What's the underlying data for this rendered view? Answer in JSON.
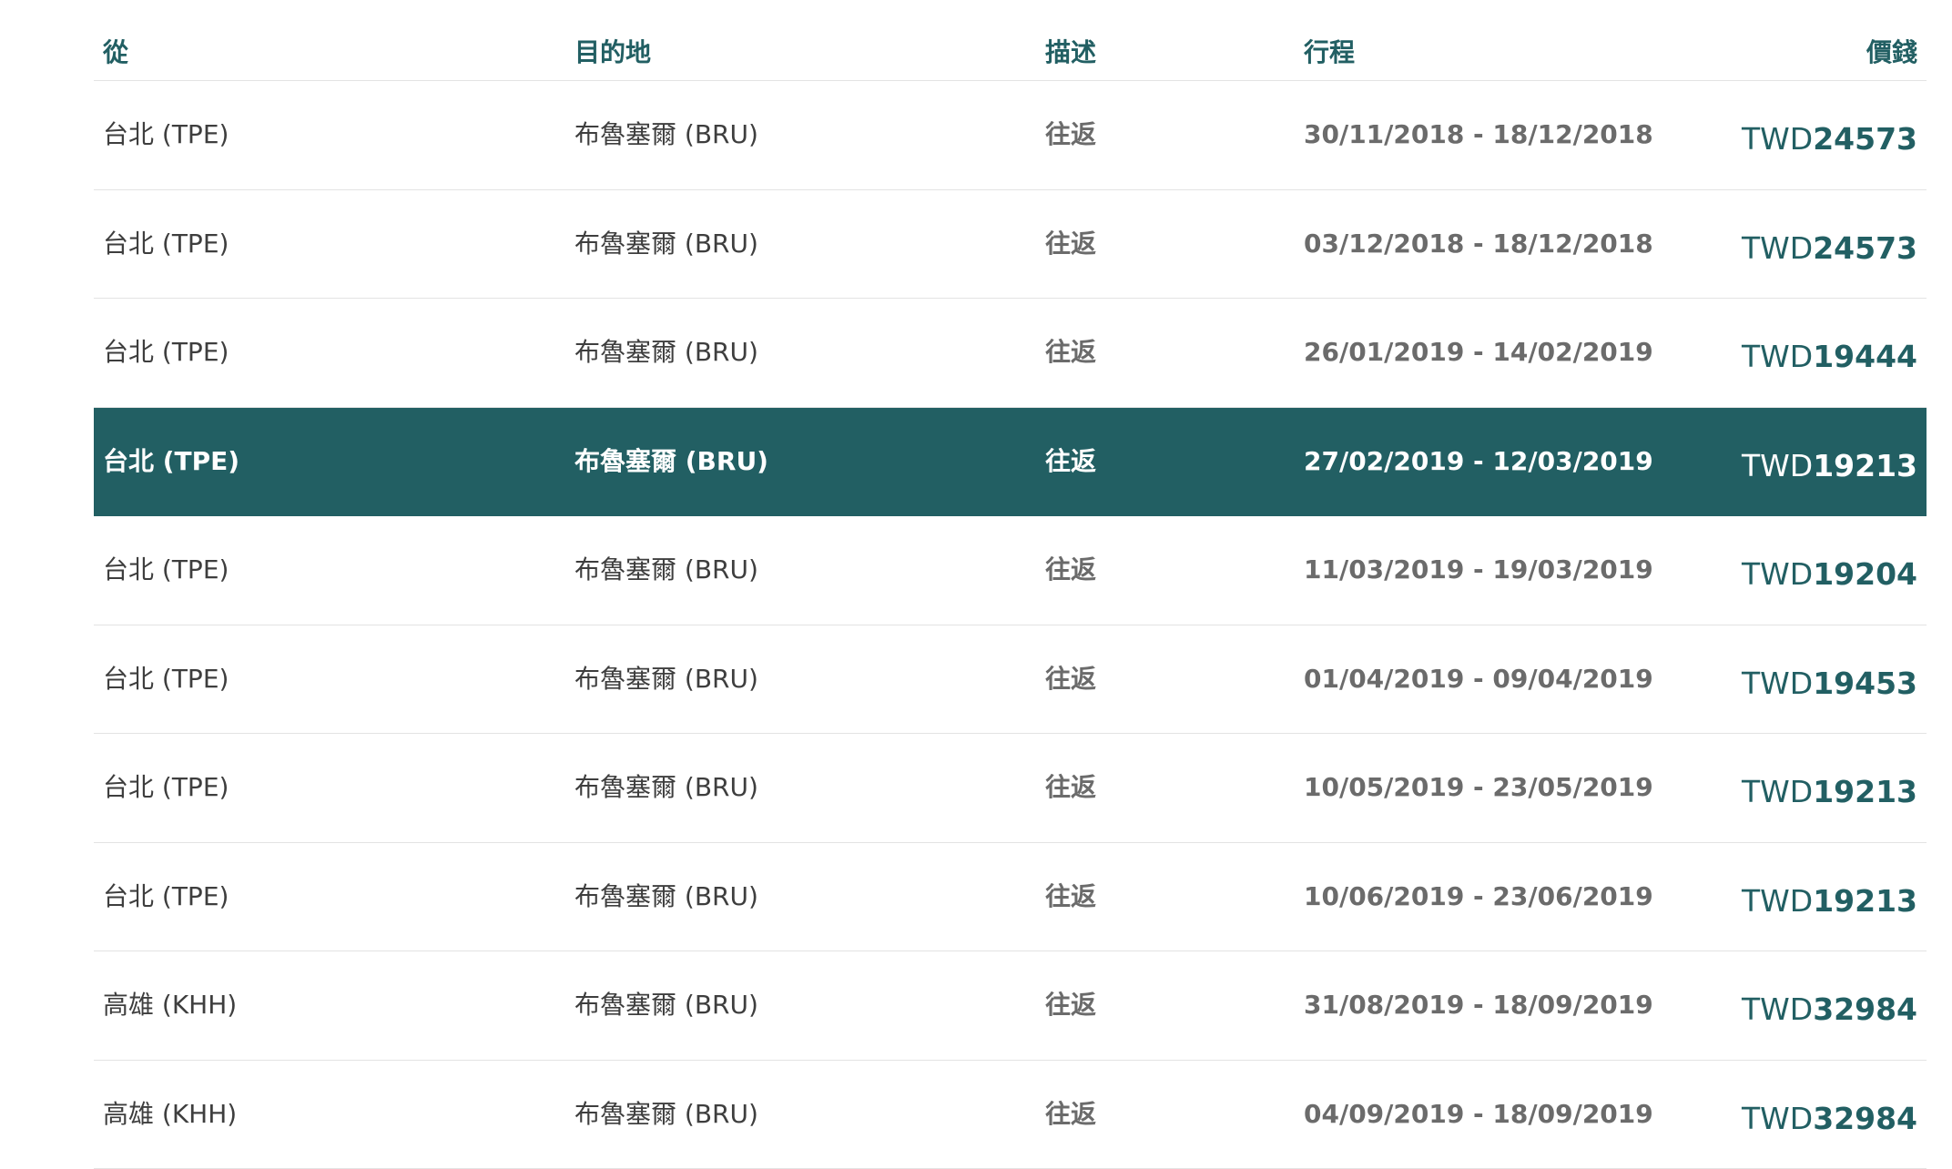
{
  "table": {
    "columns": {
      "from": "從",
      "to": "目的地",
      "description": "描述",
      "itinerary": "行程",
      "price": "價錢"
    },
    "currency": "TWD",
    "selected_index": 3,
    "rows": [
      {
        "from": "台北 (TPE)",
        "to": "布魯塞爾 (BRU)",
        "description": "往返",
        "itinerary": "30/11/2018 - 18/12/2018",
        "price": "24573"
      },
      {
        "from": "台北 (TPE)",
        "to": "布魯塞爾 (BRU)",
        "description": "往返",
        "itinerary": "03/12/2018 - 18/12/2018",
        "price": "24573"
      },
      {
        "from": "台北 (TPE)",
        "to": "布魯塞爾 (BRU)",
        "description": "往返",
        "itinerary": "26/01/2019 - 14/02/2019",
        "price": "19444"
      },
      {
        "from": "台北 (TPE)",
        "to": "布魯塞爾 (BRU)",
        "description": "往返",
        "itinerary": "27/02/2019 - 12/03/2019",
        "price": "19213"
      },
      {
        "from": "台北 (TPE)",
        "to": "布魯塞爾 (BRU)",
        "description": "往返",
        "itinerary": "11/03/2019 - 19/03/2019",
        "price": "19204"
      },
      {
        "from": "台北 (TPE)",
        "to": "布魯塞爾 (BRU)",
        "description": "往返",
        "itinerary": "01/04/2019 - 09/04/2019",
        "price": "19453"
      },
      {
        "from": "台北 (TPE)",
        "to": "布魯塞爾 (BRU)",
        "description": "往返",
        "itinerary": "10/05/2019 - 23/05/2019",
        "price": "19213"
      },
      {
        "from": "台北 (TPE)",
        "to": "布魯塞爾 (BRU)",
        "description": "往返",
        "itinerary": "10/06/2019 - 23/06/2019",
        "price": "19213"
      },
      {
        "from": "高雄 (KHH)",
        "to": "布魯塞爾 (BRU)",
        "description": "往返",
        "itinerary": "31/08/2019 - 18/09/2019",
        "price": "32984"
      },
      {
        "from": "高雄 (KHH)",
        "to": "布魯塞爾 (BRU)",
        "description": "往返",
        "itinerary": "04/09/2019 - 18/09/2019",
        "price": "32984"
      }
    ]
  },
  "colors": {
    "accent": "#225f63",
    "divider": "#e3e3e3",
    "selected_text": "#ffffff"
  }
}
